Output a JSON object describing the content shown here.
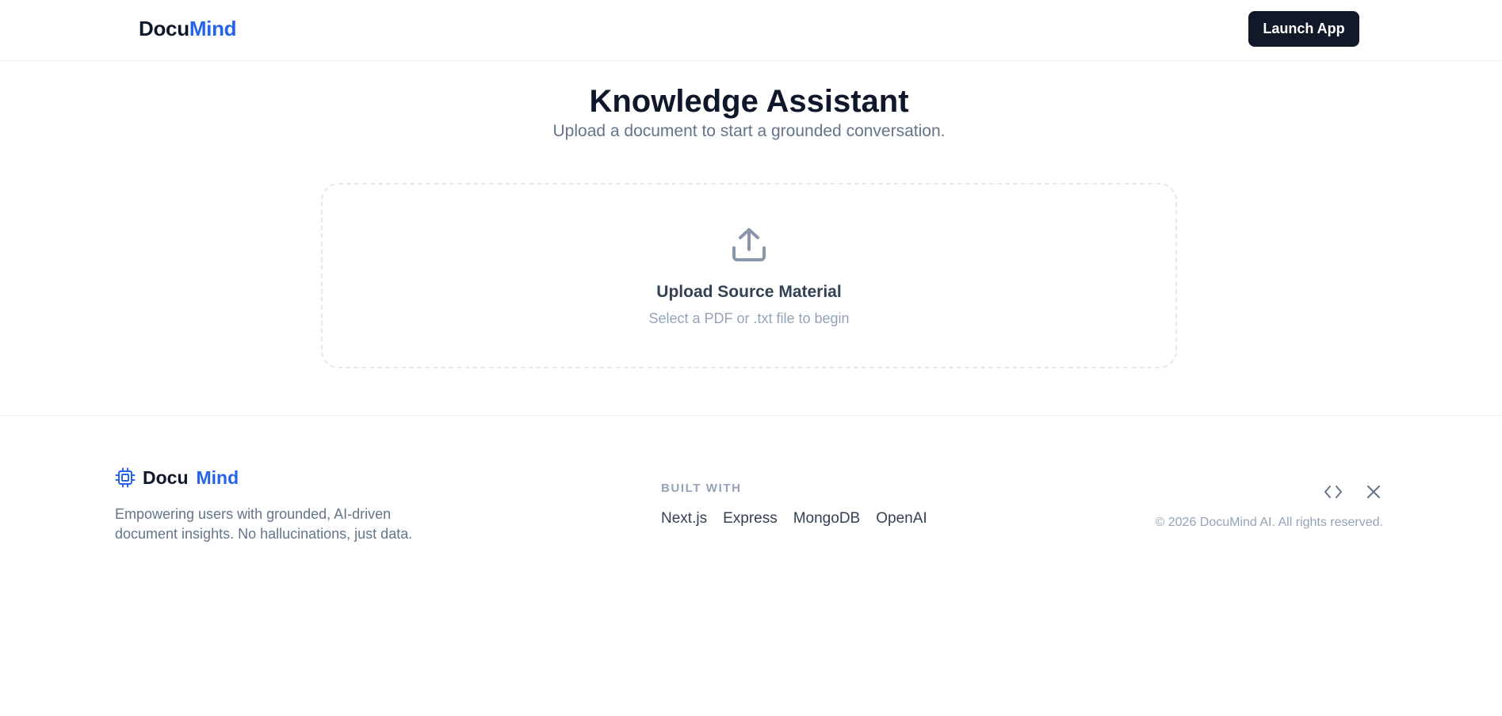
{
  "header": {
    "brand_part1": "Docu",
    "brand_part2": "Mind",
    "launch_label": "Launch App"
  },
  "hero": {
    "title": "Knowledge Assistant",
    "subtitle": "Upload a document to start a grounded conversation."
  },
  "upload": {
    "icon": "upload-icon",
    "title": "Upload Source Material",
    "hint": "Select a PDF or .txt file to begin"
  },
  "footer": {
    "logo_icon": "chip-icon",
    "brand_part1": "Docu",
    "brand_part2": "Mind",
    "description": "Empowering users with grounded, AI-driven document insights. No hallucinations, just data.",
    "built_with_label": "BUILT WITH",
    "tech": [
      "Next.js",
      "Express",
      "MongoDB",
      "OpenAI"
    ],
    "icons": [
      "code-icon",
      "close-icon"
    ],
    "copyright": "© 2026 DocuMind AI. All rights reserved."
  },
  "colors": {
    "accent": "#2563eb",
    "button_bg": "#111827",
    "text_primary": "#0f172a",
    "text_muted": "#64748b",
    "text_light": "#94a3b8"
  }
}
